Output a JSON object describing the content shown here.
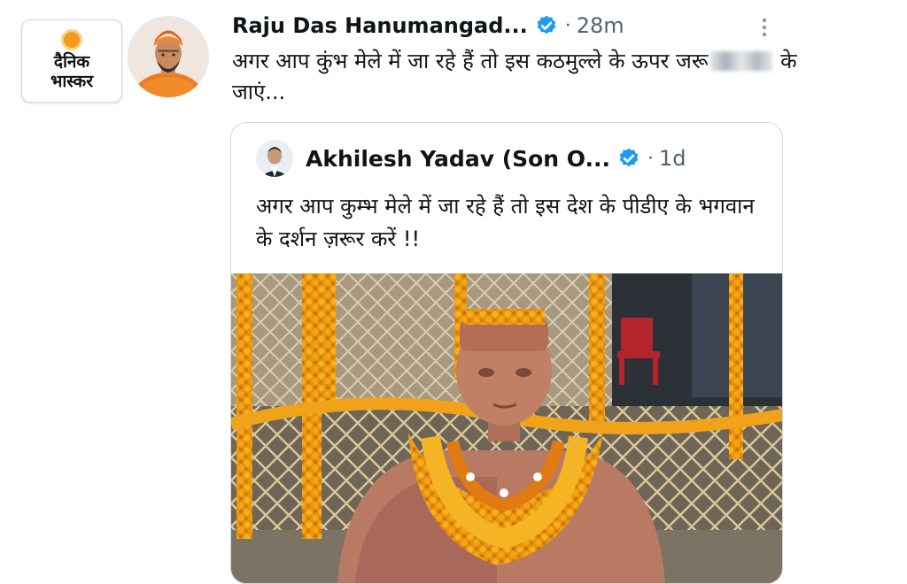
{
  "brand": {
    "line1": "दैनिक",
    "line2": "भास्कर"
  },
  "tweet": {
    "author": "Raju Das Hanumangad...",
    "verified": true,
    "time": "28m",
    "text_part1": "अगर आप कुंभ मेले में जा रहे हैं तो इस कठमुल्ले के ऊपर जरू",
    "text_part2": " के जाएं..."
  },
  "quoted": {
    "author": "Akhilesh Yadav (Son O...",
    "verified": true,
    "time": "1d",
    "text": "अगर आप कुम्भ मेले में जा रहे हैं तो इस देश के पीडीए के भगवान के दर्शन ज़रूर करें !!"
  },
  "icons": {
    "verified_badge": "verified-badge-icon",
    "more": "more-vertical-icon"
  },
  "colors": {
    "verified_blue": "#1d9bf0",
    "marigold": "#f0a21a",
    "text_dark": "#0f1419",
    "text_muted": "#536471",
    "brand_orange": "#f39a1c"
  }
}
